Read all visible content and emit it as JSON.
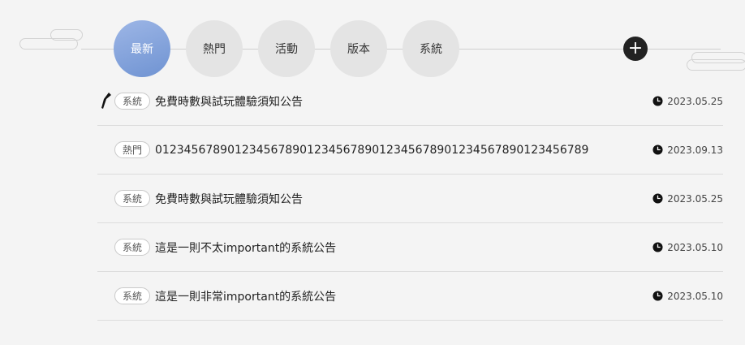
{
  "tabs": [
    {
      "label": "最新",
      "active": true
    },
    {
      "label": "熱門",
      "active": false
    },
    {
      "label": "活動",
      "active": false
    },
    {
      "label": "版本",
      "active": false
    },
    {
      "label": "系統",
      "active": false
    }
  ],
  "add_button": {
    "label": "+"
  },
  "items": [
    {
      "tag": "系統",
      "title": "免費時數與試玩體驗須知公告",
      "date": "2023.05.25",
      "pinned": true
    },
    {
      "tag": "熱門",
      "title": "012345678901234567890123456789012345678901234567890123456789",
      "date": "2023.09.13",
      "pinned": false
    },
    {
      "tag": "系統",
      "title": "免費時數與試玩體驗須知公告",
      "date": "2023.05.25",
      "pinned": false
    },
    {
      "tag": "系統",
      "title": "這是一則不太important的系統公告",
      "date": "2023.05.10",
      "pinned": false
    },
    {
      "tag": "系統",
      "title": "這是一則非常important的系統公告",
      "date": "2023.05.10",
      "pinned": false
    }
  ],
  "icons": {
    "pin": "pin-icon",
    "clock": "clock-icon"
  },
  "colors": {
    "accent": "#7f9fdc",
    "tab_bg": "#e4e4e4",
    "add_bg": "#222222"
  }
}
